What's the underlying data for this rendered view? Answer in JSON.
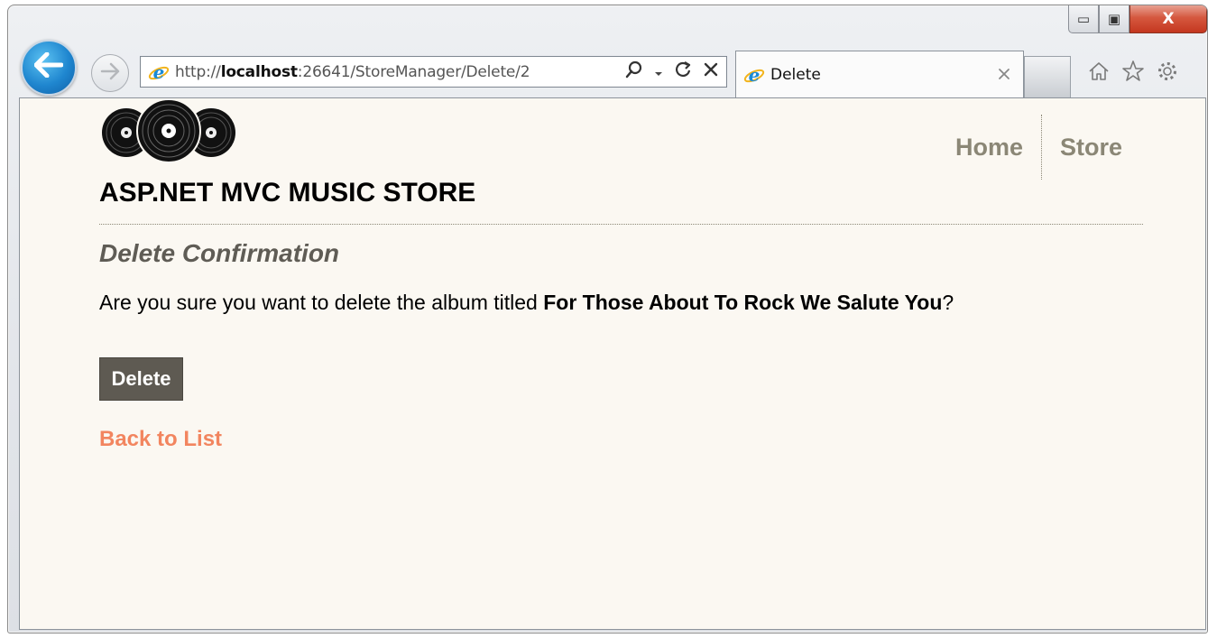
{
  "browser": {
    "url_prefix": "http://",
    "url_host": "localhost",
    "url_rest": ":26641/StoreManager/Delete/2",
    "tab_title": "Delete",
    "window_controls": {
      "minimize": "▭",
      "maximize": "▣",
      "close": "X"
    }
  },
  "site": {
    "title": "ASP.NET MVC MUSIC STORE",
    "nav": [
      "Home",
      "Store"
    ]
  },
  "page": {
    "heading": "Delete Confirmation",
    "prompt_before": "Are you sure you want to delete the album titled ",
    "album_title": "For Those About To Rock We Salute You",
    "prompt_after": "?",
    "delete_button": "Delete",
    "back_link": "Back to List"
  },
  "colors": {
    "page_background": "#fbf8f2",
    "nav_link": "#8b8776",
    "heading": "#5f5c55",
    "button_bg": "#5e5a52",
    "link": "#f2855f",
    "browser_back_blue": "#1f86cf"
  },
  "icons": [
    "back-arrow-icon",
    "forward-arrow-icon",
    "ie-logo-icon",
    "search-icon",
    "refresh-icon",
    "stop-icon",
    "home-icon",
    "favorites-star-icon",
    "settings-gear-icon",
    "vinyl-records-logo"
  ]
}
